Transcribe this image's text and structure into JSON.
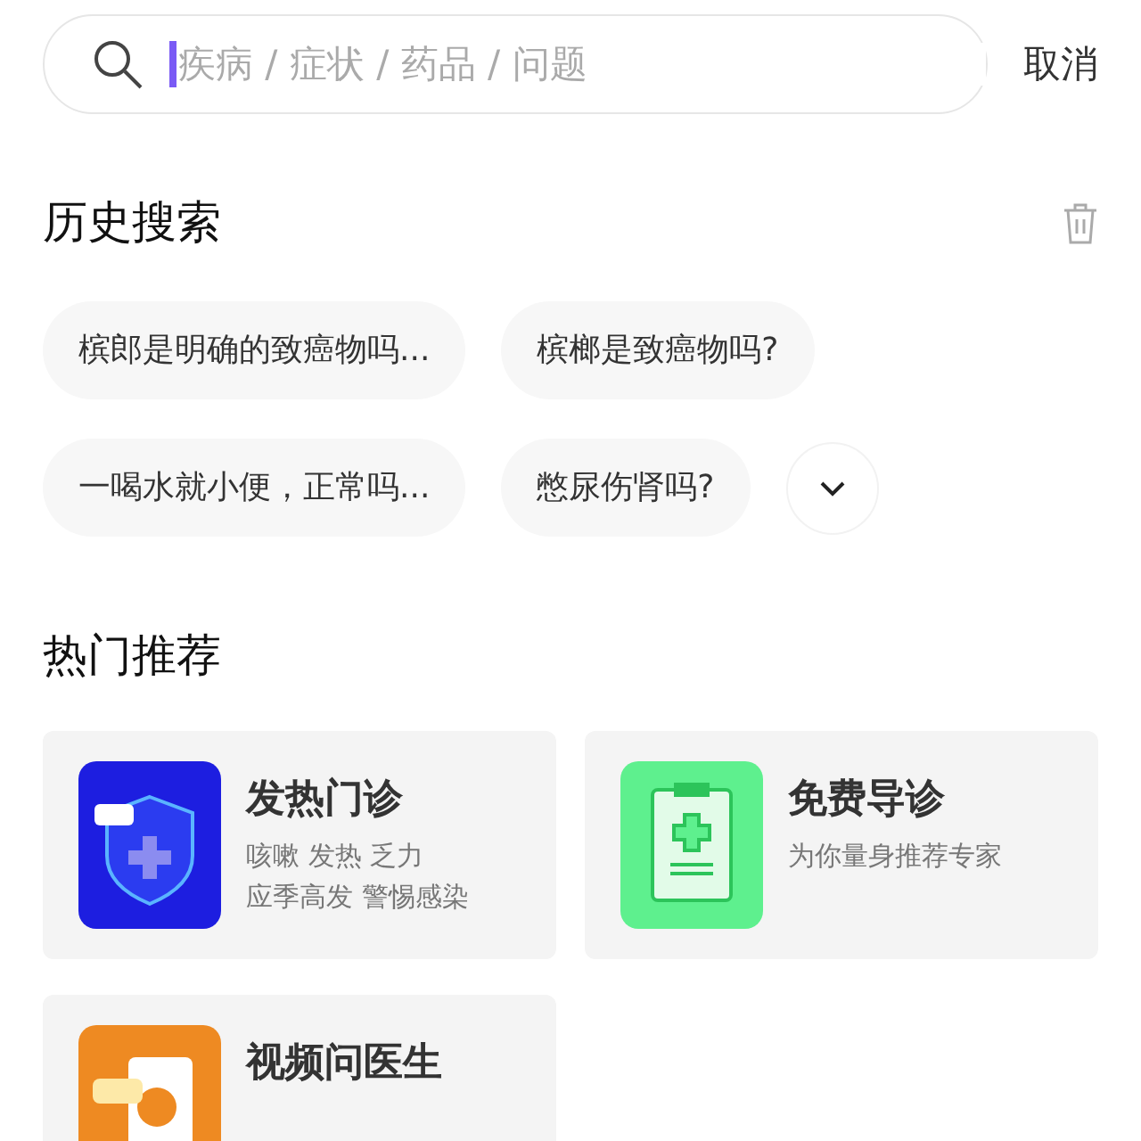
{
  "search": {
    "placeholder": "疾病 / 症状 / 药品 / 问题",
    "cancel": "取消"
  },
  "history": {
    "title": "历史搜索",
    "items": [
      "槟郎是明确的致癌物吗...",
      "槟榔是致癌物吗?",
      "一喝水就小便，正常吗...",
      "憋尿伤肾吗?"
    ]
  },
  "hot": {
    "title": "热门推荐",
    "cards": [
      {
        "kind": "shield",
        "title": "发热门诊",
        "lines": [
          "咳嗽 发热 乏力",
          "应季高发  警惕感染"
        ]
      },
      {
        "kind": "clipboard",
        "title": "免费导诊",
        "lines": [
          "为你量身推荐专家"
        ]
      },
      {
        "kind": "video",
        "title": "视频问医生"
      }
    ]
  }
}
